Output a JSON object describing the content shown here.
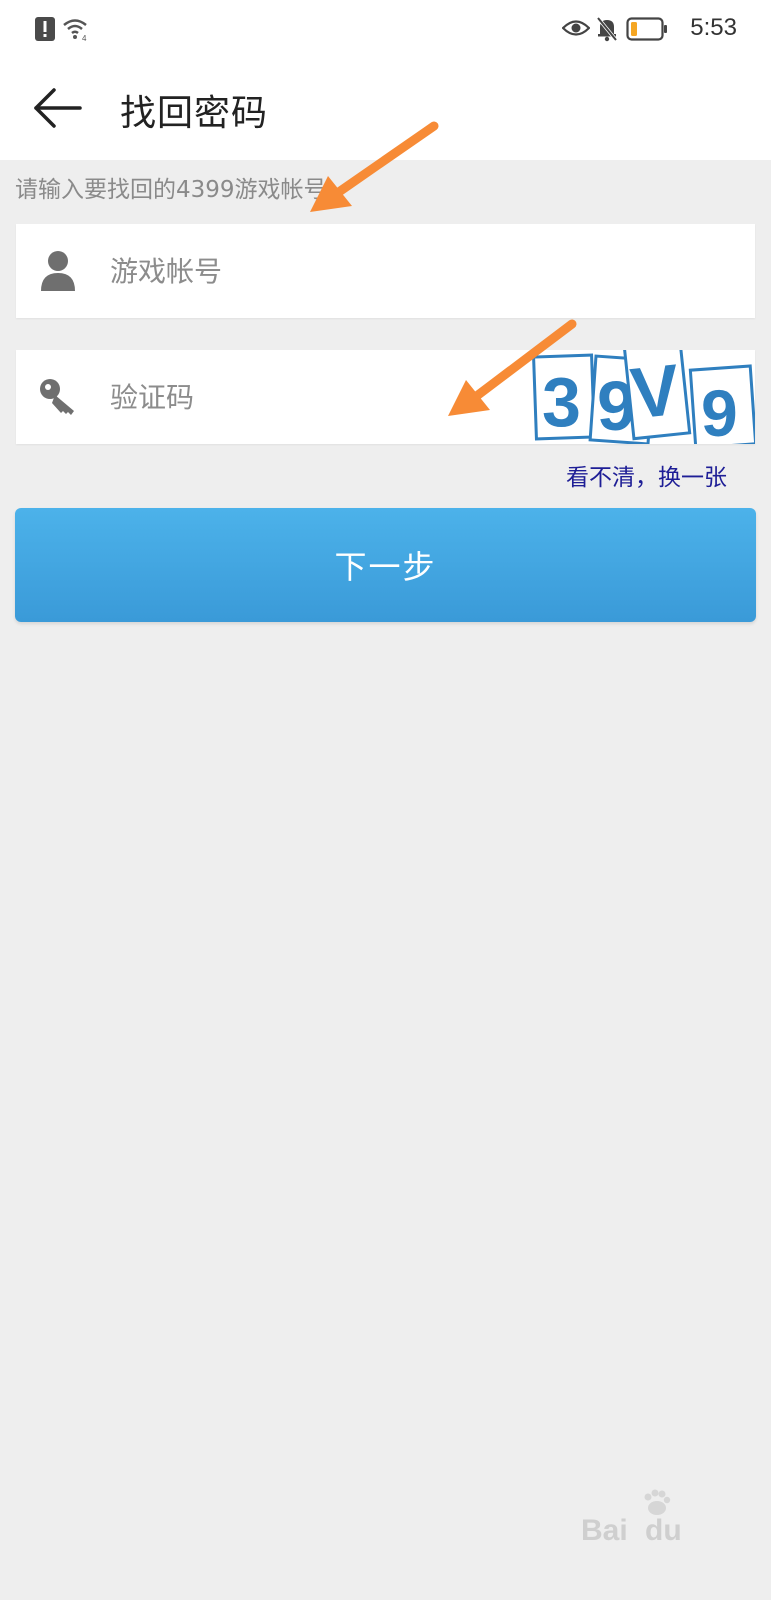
{
  "status_bar": {
    "time": "5:53"
  },
  "header": {
    "title": "找回密码"
  },
  "form": {
    "hint": "请输入要找回的4399游戏帐号",
    "account_placeholder": "游戏帐号",
    "captcha_placeholder": "验证码",
    "captcha_chars": [
      "3",
      "9",
      "V",
      "9"
    ],
    "refresh_label": "看不清，换一张",
    "next_label": "下一步"
  },
  "watermark": {
    "text": "Bai",
    "text2": "du"
  },
  "icons": {
    "back": "arrow-left-icon",
    "account": "user-icon",
    "captcha": "key-icon",
    "annotation": "orange-arrow-icon"
  },
  "colors": {
    "button": "#3fa4e0",
    "link": "#1e1e96",
    "annotation": "#f78b36",
    "captcha_digits": "#2f7fbf",
    "background": "#eeeeee"
  }
}
